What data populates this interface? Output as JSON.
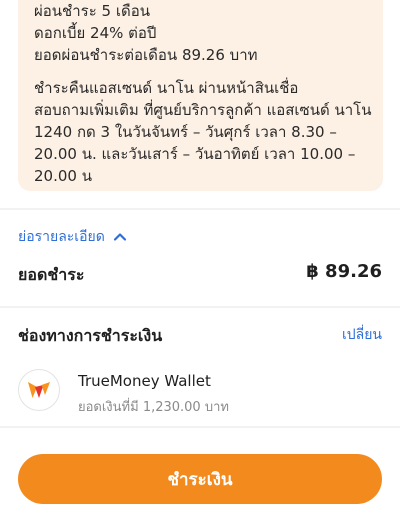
{
  "installment_info": {
    "lines": [
      "ผ่อนชำระ 5 เดือน",
      "ดอกเบี้ย 24% ต่อปี",
      "ยอดผ่อนชำระต่อเดือน 89.26 บาท",
      "ชำระคืนแอสเซนด์ นาโน ผ่านหน้าสินเชื่อ",
      "สอบถามเพิ่มเติม ที่ศูนย์บริการลูกค้า แอสเซนด์ นาโน",
      "1240 กด 3 ในวันจันทร์ – วันศุกร์ เวลา 8.30 –",
      "20.00 น. และวันเสาร์ – วันอาทิตย์ เวลา 10.00 –",
      "20.00 น"
    ]
  },
  "summary": {
    "collapse_label": "ย่อรายละเอียด",
    "collapse_icon": "chevron-up-icon",
    "total_label": "ยอดชำระ",
    "total_value": "฿ 89.26"
  },
  "payment_method": {
    "title": "ช่องทางการชำระเงิน",
    "change_label": "เปลี่ยน",
    "wallet_name": "TrueMoney Wallet",
    "wallet_balance": "ยอดเงินที่มี 1,230.00 บาท",
    "wallet_icon": "truemoney-logo-icon"
  },
  "footer": {
    "pay_button_label": "ชำระเงิน"
  },
  "colors": {
    "accent_orange": "#f38a1e",
    "link_blue": "#2f6fd6",
    "note_bg": "#fdf1e6",
    "logo_orange": "#f7931e",
    "logo_red": "#e5322d"
  }
}
